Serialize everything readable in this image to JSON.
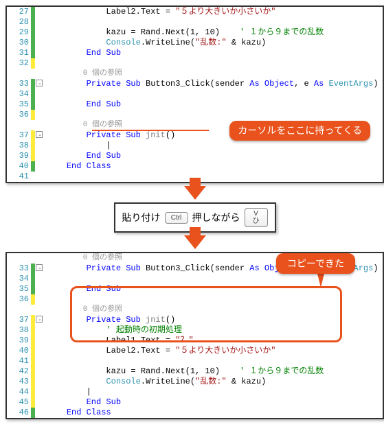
{
  "callouts": {
    "cursor_here": "カーソルをここに持ってくる",
    "copied": "コピーできた"
  },
  "paste_label": "貼り付け",
  "key_ctrl": "Ctrl",
  "press_while": "押しながら",
  "key_v_top": "V",
  "key_v_bottom": "ひ",
  "ref_label": "0 個の参照",
  "top": {
    "lines": {
      "27": {
        "indent": "            ",
        "parts": [
          {
            "t": "Label2.Text = ",
            "c": "norm"
          },
          {
            "t": "\"５より大きいか小さいか\"",
            "c": "str"
          }
        ]
      },
      "28": {
        "indent": "",
        "parts": []
      },
      "29": {
        "indent": "            ",
        "parts": [
          {
            "t": "kazu = Rand.Next(1, 10)    ",
            "c": "norm"
          },
          {
            "t": "' １から９までの乱数",
            "c": "com"
          }
        ]
      },
      "30": {
        "indent": "            ",
        "parts": [
          {
            "t": "Console",
            "c": "type"
          },
          {
            "t": ".WriteLine(",
            "c": "norm"
          },
          {
            "t": "\"乱数:\"",
            "c": "str"
          },
          {
            "t": " & kazu)",
            "c": "norm"
          }
        ]
      },
      "31": {
        "indent": "        ",
        "parts": [
          {
            "t": "End Sub",
            "c": "kw"
          }
        ]
      },
      "32": {
        "indent": "",
        "parts": []
      },
      "33": {
        "indent": "        ",
        "parts": [
          {
            "t": "Private Sub",
            "c": "kw"
          },
          {
            "t": " Button3_Click(sender ",
            "c": "norm"
          },
          {
            "t": "As",
            "c": "kw"
          },
          {
            "t": " ",
            "c": "norm"
          },
          {
            "t": "Object",
            "c": "kw"
          },
          {
            "t": ", e ",
            "c": "norm"
          },
          {
            "t": "As",
            "c": "kw"
          },
          {
            "t": " ",
            "c": "norm"
          },
          {
            "t": "EventArgs",
            "c": "type"
          },
          {
            "t": ") H",
            "c": "norm"
          }
        ]
      },
      "34": {
        "indent": "",
        "parts": []
      },
      "35": {
        "indent": "        ",
        "parts": [
          {
            "t": "End Sub",
            "c": "kw"
          }
        ]
      },
      "36": {
        "indent": "",
        "parts": []
      },
      "37": {
        "indent": "        ",
        "parts": [
          {
            "t": "Private Sub",
            "c": "kw"
          },
          {
            "t": " ",
            "c": "norm"
          },
          {
            "t": "jnit",
            "c": "ident"
          },
          {
            "t": "()",
            "c": "norm"
          }
        ]
      },
      "38": {
        "indent": "            ",
        "parts": [
          {
            "t": "|",
            "c": "norm"
          }
        ]
      },
      "39": {
        "indent": "        ",
        "parts": [
          {
            "t": "End Sub",
            "c": "kw"
          }
        ]
      },
      "40": {
        "indent": "    ",
        "parts": [
          {
            "t": "End Class",
            "c": "kw"
          }
        ]
      },
      "41": {
        "indent": "",
        "parts": []
      }
    }
  },
  "bottom": {
    "lines": {
      "33": {
        "indent": "        ",
        "parts": [
          {
            "t": "Private Sub",
            "c": "kw"
          },
          {
            "t": " Button3_Click(sender ",
            "c": "norm"
          },
          {
            "t": "As",
            "c": "kw"
          },
          {
            "t": " ",
            "c": "norm"
          },
          {
            "t": "Object",
            "c": "kw"
          },
          {
            "t": ", e ",
            "c": "norm"
          },
          {
            "t": "As",
            "c": "kw"
          },
          {
            "t": " ",
            "c": "norm"
          },
          {
            "t": "EventArgs",
            "c": "type"
          },
          {
            "t": ") H",
            "c": "norm"
          }
        ]
      },
      "34": {
        "indent": "",
        "parts": []
      },
      "35": {
        "indent": "        ",
        "parts": [
          {
            "t": "End Sub",
            "c": "kw"
          }
        ]
      },
      "36": {
        "indent": "",
        "parts": []
      },
      "37": {
        "indent": "        ",
        "parts": [
          {
            "t": "Private Sub",
            "c": "kw"
          },
          {
            "t": " ",
            "c": "norm"
          },
          {
            "t": "jnit",
            "c": "ident"
          },
          {
            "t": "()",
            "c": "norm"
          }
        ]
      },
      "38": {
        "indent": "            ",
        "parts": [
          {
            "t": "' 起動時の初期処理",
            "c": "com"
          }
        ]
      },
      "39": {
        "indent": "            ",
        "parts": [
          {
            "t": "Label1.Text = ",
            "c": "norm"
          },
          {
            "t": "\"？\"",
            "c": "str"
          }
        ]
      },
      "40": {
        "indent": "            ",
        "parts": [
          {
            "t": "Label2.Text = ",
            "c": "norm"
          },
          {
            "t": "\"５より大きいか小さいか\"",
            "c": "str"
          }
        ]
      },
      "41": {
        "indent": "",
        "parts": []
      },
      "42": {
        "indent": "            ",
        "parts": [
          {
            "t": "kazu = Rand.Next(1, 10)    ",
            "c": "norm"
          },
          {
            "t": "' １から９までの乱数",
            "c": "com"
          }
        ]
      },
      "43": {
        "indent": "            ",
        "parts": [
          {
            "t": "Console",
            "c": "type"
          },
          {
            "t": ".WriteLine(",
            "c": "norm"
          },
          {
            "t": "\"乱数:\"",
            "c": "str"
          },
          {
            "t": " & kazu)",
            "c": "norm"
          }
        ]
      },
      "44": {
        "indent": "        ",
        "parts": [
          {
            "t": "|",
            "c": "norm"
          }
        ]
      },
      "45": {
        "indent": "        ",
        "parts": [
          {
            "t": "End Sub",
            "c": "kw"
          }
        ]
      },
      "46": {
        "indent": "    ",
        "parts": [
          {
            "t": "End Class",
            "c": "kw"
          }
        ]
      }
    }
  }
}
